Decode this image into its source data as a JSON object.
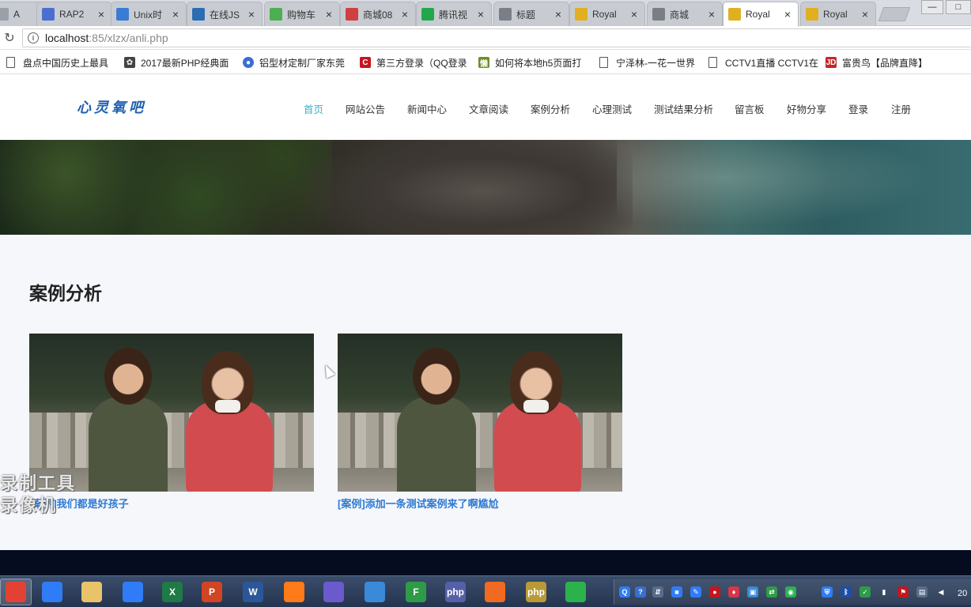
{
  "browser": {
    "tabs": [
      {
        "title": "A",
        "icon": "generic-icon",
        "color": "#9aa0a8"
      },
      {
        "title": "RAP2",
        "icon": "rap2-icon",
        "color": "#4a6fd0"
      },
      {
        "title": "Unix时",
        "icon": "unix-icon",
        "color": "#3a7bd5"
      },
      {
        "title": "在线JS",
        "icon": "code-icon",
        "color": "#2a6db5"
      },
      {
        "title": "购物车",
        "icon": "cart-icon",
        "color": "#4caf50"
      },
      {
        "title": "商城08",
        "icon": "shop-icon",
        "color": "#d04040"
      },
      {
        "title": "腾讯视",
        "icon": "video-icon",
        "color": "#22a84a"
      },
      {
        "title": "标题",
        "icon": "globe-icon",
        "color": "#7a7f86"
      },
      {
        "title": "Royal",
        "icon": "crown-icon",
        "color": "#e0b020"
      },
      {
        "title": "商城",
        "icon": "page-icon",
        "color": "#7a7f86"
      },
      {
        "title": "Royal",
        "icon": "crown-icon",
        "color": "#e0b020"
      },
      {
        "title": "Royal",
        "icon": "crown-icon",
        "color": "#e0b020"
      }
    ],
    "close_glyph": "×",
    "window_controls": {
      "min": "—",
      "max": "□"
    },
    "url_host": "localhost",
    "url_path": ":85/xlzx/anli.php",
    "bookmarks": [
      {
        "label": "盘点中国历史上最具",
        "icon": "doc-icon"
      },
      {
        "label": "2017最新PHP经典面",
        "icon": "github-icon"
      },
      {
        "label": "铝型材定制厂家东莞",
        "icon": "brand-icon"
      },
      {
        "label": "第三方登录（QQ登录",
        "icon": "c-icon"
      },
      {
        "label": "如何将本地h5页面打",
        "icon": "logo-icon"
      },
      {
        "label": "宁泽林-一花一世界",
        "icon": "doc-icon"
      },
      {
        "label": "CCTV1直播 CCTV1在",
        "icon": "doc-icon"
      },
      {
        "label": "富贵鸟【品牌直降】",
        "icon": "jd-icon"
      }
    ]
  },
  "site": {
    "logo": "心灵氧吧",
    "nav": [
      "首页",
      "网站公告",
      "新闻中心",
      "文章阅读",
      "案例分析",
      "心理测试",
      "测试结果分析",
      "留言板",
      "好物分享",
      "登录",
      "注册"
    ],
    "nav_active_color": "#3ab0c8",
    "section_title": "案例分析",
    "cards": [
      {
        "title": "[案例]我们都是好孩子"
      },
      {
        "title": "[案例]添加一条测试案例来了啊尴尬"
      }
    ],
    "link_color": "#2f7ad1"
  },
  "overlay": {
    "watermark_line1": "录制工具",
    "watermark_line2": "录像机"
  },
  "taskbar": {
    "apps": [
      {
        "name": "chrome",
        "label": "",
        "color": "#e34133"
      },
      {
        "name": "baidu-netdisk",
        "label": "",
        "color": "#2f7cf6"
      },
      {
        "name": "file-explorer",
        "label": "",
        "color": "#e8c36a"
      },
      {
        "name": "notes",
        "label": "",
        "color": "#2f7cf6"
      },
      {
        "name": "excel",
        "label": "X",
        "color": "#1f7a45"
      },
      {
        "name": "powerpoint",
        "label": "P",
        "color": "#d14424"
      },
      {
        "name": "word",
        "label": "W",
        "color": "#2b579a"
      },
      {
        "name": "firefox",
        "label": "",
        "color": "#ff7a18"
      },
      {
        "name": "music",
        "label": "",
        "color": "#6a5acd"
      },
      {
        "name": "remote-desktop",
        "label": "",
        "color": "#3b8ad9"
      },
      {
        "name": "ftp",
        "label": "F",
        "color": "#2e9b46"
      },
      {
        "name": "php-tool",
        "label": "php",
        "color": "#5560a8"
      },
      {
        "name": "postman",
        "label": "",
        "color": "#f06a22"
      },
      {
        "name": "php-storm",
        "label": "php",
        "color": "#b99a37"
      },
      {
        "name": "wechat",
        "label": "",
        "color": "#2bb24c"
      }
    ],
    "clock": "20"
  }
}
